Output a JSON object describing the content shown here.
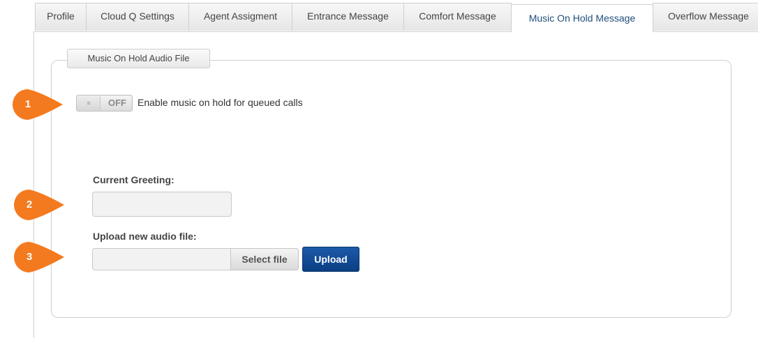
{
  "tabs": [
    {
      "label": "Profile",
      "active": false
    },
    {
      "label": "Cloud Q Settings",
      "active": false
    },
    {
      "label": "Agent Assigment",
      "active": false
    },
    {
      "label": "Entrance Message",
      "active": false
    },
    {
      "label": "Comfort Message",
      "active": false
    },
    {
      "label": "Music On Hold Message",
      "active": true
    },
    {
      "label": "Overflow Message",
      "active": false
    }
  ],
  "section": {
    "legend": "Music On Hold Audio File"
  },
  "toggle": {
    "state_label": "OFF",
    "enabled": false,
    "label": "Enable music on hold for queued calls"
  },
  "current_greeting": {
    "label": "Current Greeting:",
    "value": ""
  },
  "upload": {
    "label": "Upload new audio file:",
    "file_value": "",
    "select_label": "Select file",
    "upload_label": "Upload"
  },
  "callouts": [
    "1",
    "2",
    "3"
  ],
  "colors": {
    "callout": "#f47a1f",
    "upload_button": "#0f4a92",
    "active_tab_text": "#1f4e79"
  }
}
